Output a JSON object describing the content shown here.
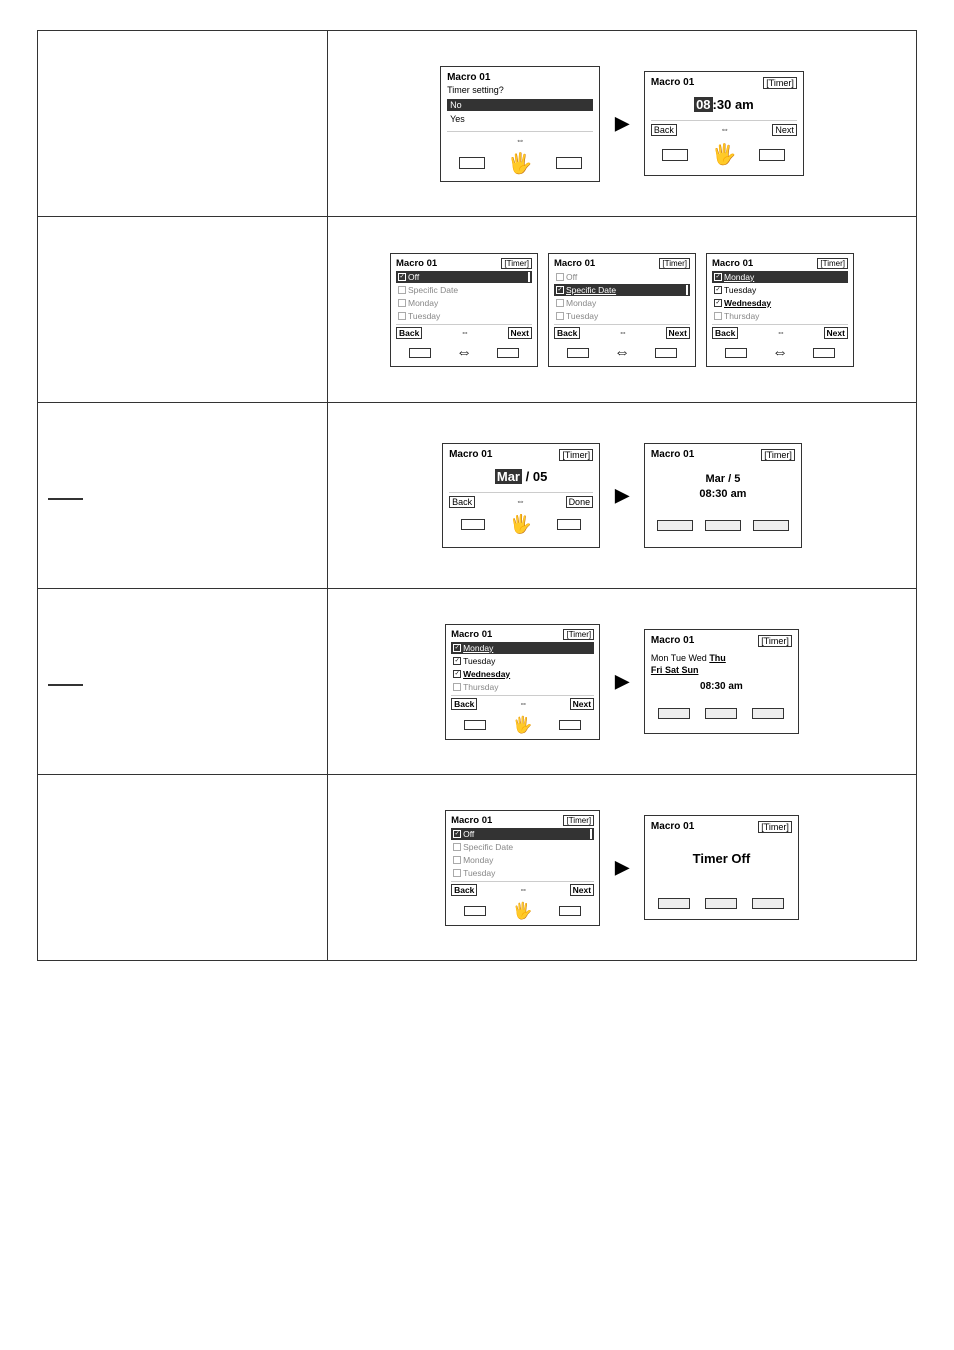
{
  "rows": [
    {
      "id": "row1",
      "left": "",
      "screens": [
        {
          "id": "screen1a",
          "title": "Macro 01",
          "tag": "",
          "type": "menu",
          "prompt": "Timer setting?",
          "items": [
            {
              "label": "No",
              "selected": true
            },
            {
              "label": "Yes",
              "selected": false
            }
          ],
          "footer": {
            "center": "⇔"
          },
          "hasHands": true
        },
        {
          "id": "screen1b",
          "type": "arrow"
        },
        {
          "id": "screen1c",
          "title": "Macro 01",
          "tag": "[Timer]",
          "type": "time",
          "time": "08:30 am",
          "timeHighlight": "08",
          "footer": {
            "left": "Back",
            "center": "⇔",
            "right": "Next"
          },
          "hasHands": true
        }
      ]
    },
    {
      "id": "row2",
      "left": "",
      "screens": [
        {
          "id": "screen2a",
          "title": "Macro 01",
          "tag": "[Timer]",
          "type": "checklist",
          "items": [
            {
              "label": "Off",
              "checked": true,
              "selected": true
            },
            {
              "label": "Specific Date",
              "checked": false
            },
            {
              "label": "Monday",
              "checked": false
            },
            {
              "label": "Tuesday",
              "checked": false
            }
          ],
          "footer": {
            "left": "Back",
            "center": "⇔",
            "right": "Next"
          },
          "hasHands": true
        },
        {
          "id": "screen2b",
          "title": "Macro 01",
          "tag": "[Timer]",
          "type": "checklist",
          "items": [
            {
              "label": "Off",
              "checked": false
            },
            {
              "label": "Specific Date",
              "checked": true,
              "selected": true
            },
            {
              "label": "Monday",
              "checked": false
            },
            {
              "label": "Tuesday",
              "checked": false
            }
          ],
          "footer": {
            "left": "Back",
            "center": "⇔",
            "right": "Next"
          },
          "hasHands": true
        },
        {
          "id": "screen2c",
          "title": "Macro 01",
          "tag": "[Timer]",
          "type": "checklist",
          "items": [
            {
              "label": "Monday",
              "checked": true,
              "selected": true
            },
            {
              "label": "Tuesday",
              "checked": true
            },
            {
              "label": "Wednesday",
              "checked": true
            },
            {
              "label": "Thursday",
              "checked": false
            }
          ],
          "footer": {
            "left": "Back",
            "center": "⇔",
            "right": "Next"
          },
          "hasHands": true
        }
      ]
    },
    {
      "id": "row3a",
      "left": "specific_date",
      "screens": [
        {
          "id": "screen3a",
          "title": "Macro 01",
          "tag": "[Timer]",
          "type": "date_input",
          "date": "Mar / 05",
          "dateHighlight": "Mar",
          "footer": {
            "left": "Back",
            "center": "⇔",
            "right": "Done"
          },
          "hasHands": true
        },
        {
          "id": "screen3b",
          "type": "arrow"
        },
        {
          "id": "screen3c",
          "title": "Macro 01",
          "tag": "[Timer]",
          "type": "summary_date",
          "line1": "Mar / 5",
          "line2": "08:30 am",
          "hasHands": false
        }
      ]
    },
    {
      "id": "row3b",
      "left": "weekly",
      "screens": [
        {
          "id": "screen4a",
          "title": "Macro 01",
          "tag": "[Timer]",
          "type": "checklist",
          "items": [
            {
              "label": "Monday",
              "checked": true,
              "selected": true
            },
            {
              "label": "Tuesday",
              "checked": true
            },
            {
              "label": "Wednesday",
              "checked": true
            },
            {
              "label": "Thursday",
              "checked": false
            }
          ],
          "footer": {
            "left": "Back",
            "center": "⇔",
            "right": "Next"
          },
          "hasHands": true
        },
        {
          "id": "screen4b",
          "type": "arrow"
        },
        {
          "id": "screen4c",
          "title": "Macro 01",
          "tag": "[Timer]",
          "type": "summary_weekly",
          "days": [
            {
              "label": "Mon",
              "active": true
            },
            {
              "label": "Tue",
              "active": true
            },
            {
              "label": "Wed",
              "active": true
            },
            {
              "label": "Thu",
              "active": false,
              "bold": true
            },
            {
              "label": "Fri",
              "active": false,
              "bold": true
            },
            {
              "label": "Sat",
              "active": false,
              "bold": true
            },
            {
              "label": "Sun",
              "active": false,
              "bold": true
            }
          ],
          "time": "08:30 am",
          "hasHands": false
        }
      ]
    },
    {
      "id": "row3c",
      "left": "off",
      "screens": [
        {
          "id": "screen5a",
          "title": "Macro 01",
          "tag": "[Timer]",
          "type": "checklist",
          "items": [
            {
              "label": "Off",
              "checked": true,
              "selected": true
            },
            {
              "label": "Specific Date",
              "checked": false
            },
            {
              "label": "Monday",
              "checked": false
            },
            {
              "label": "Tuesday",
              "checked": false
            }
          ],
          "footer": {
            "left": "Back",
            "center": "⇔",
            "right": "Next"
          },
          "hasHands": true
        },
        {
          "id": "screen5b",
          "type": "arrow"
        },
        {
          "id": "screen5c",
          "title": "Macro 01",
          "tag": "[Timer]",
          "type": "timer_off",
          "message": "Timer Off",
          "hasHands": false
        }
      ]
    }
  ],
  "labels": {
    "back": "Back",
    "next": "Next",
    "done": "Done",
    "timer_off": "Timer Off"
  }
}
